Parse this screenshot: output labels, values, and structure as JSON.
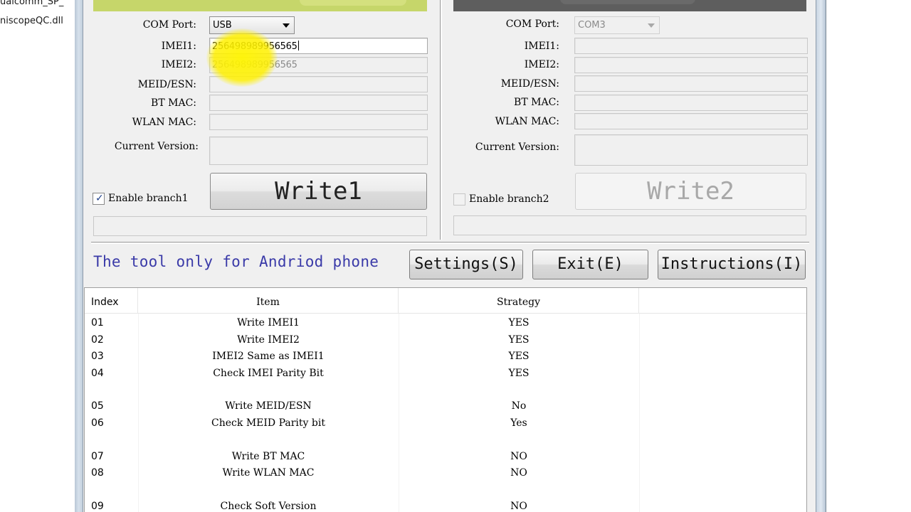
{
  "background": {
    "files": [
      "ualcomm_SP_",
      "niscopeQC.dll"
    ]
  },
  "branch1": {
    "com_port_label": "COM Port:",
    "com_port_value": "USB",
    "imei1_label": "IMEI1:",
    "imei1_value": "256498989956565",
    "imei2_label": "IMEI2:",
    "imei2_value": "256498989956565",
    "meid_label": "MEID/ESN:",
    "bt_label": "BT MAC:",
    "wlan_label": "WLAN MAC:",
    "version_label": "Current Version:",
    "write_label": "Write1",
    "enable_label": "Enable branch1",
    "enabled": true
  },
  "branch2": {
    "com_port_label": "COM Port:",
    "com_port_value": "COM3",
    "imei1_label": "IMEI1:",
    "imei2_label": "IMEI2:",
    "meid_label": "MEID/ESN:",
    "bt_label": "BT MAC:",
    "wlan_label": "WLAN MAC:",
    "version_label": "Current Version:",
    "write_label": "Write2",
    "enable_label": "Enable branch2",
    "enabled": false
  },
  "notice": "The tool only for Andriod phone",
  "buttons": {
    "settings": "Settings(S)",
    "exit": "Exit(E)",
    "instructions": "Instructions(I)"
  },
  "table": {
    "headers": [
      "Index",
      "Item",
      "Strategy"
    ],
    "rows": [
      {
        "index": "01",
        "item": "Write IMEI1",
        "strategy": "YES"
      },
      {
        "index": "02",
        "item": "Write IMEI2",
        "strategy": "YES"
      },
      {
        "index": "03",
        "item": "IMEI2 Same as IMEI1",
        "strategy": "YES"
      },
      {
        "index": "04",
        "item": "Check IMEI Parity Bit",
        "strategy": "YES"
      },
      {
        "index": "05",
        "item": "Write MEID/ESN",
        "strategy": "No"
      },
      {
        "index": "06",
        "item": "Check MEID Parity bit",
        "strategy": "Yes"
      },
      {
        "index": "07",
        "item": "Write BT MAC",
        "strategy": "NO"
      },
      {
        "index": "08",
        "item": "Write WLAN MAC",
        "strategy": "NO"
      },
      {
        "index": "09",
        "item": "Check Soft Version",
        "strategy": "NO"
      }
    ]
  }
}
